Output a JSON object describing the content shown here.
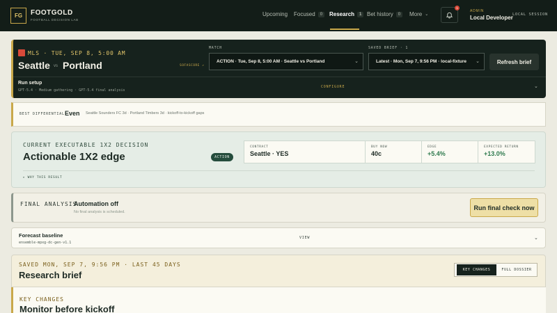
{
  "brand": {
    "logo": "FG",
    "name": "FOOTGOLD",
    "tagline": "FOOTBALL DECISION LAB"
  },
  "nav": [
    {
      "label": "Upcoming"
    },
    {
      "label": "Focused",
      "count": "0"
    },
    {
      "label": "Research",
      "count": "1",
      "active": true
    },
    {
      "label": "Bet history",
      "count": "0"
    },
    {
      "label": "More"
    }
  ],
  "notifications": {
    "count": "1",
    "icon": "bell-icon"
  },
  "user": {
    "role": "ADMIN",
    "name": "Local Developer",
    "session": "LOCAL SESSION"
  },
  "match": {
    "league": "MLS · TUE, SEP 8, 5:00 AM",
    "home": "Seattle",
    "vs": "vs",
    "away": "Portland",
    "source": "SOFASCORE ↗",
    "match_label": "MATCH",
    "match_value": "ACTION · Tue, Sep 8, 5:00 AM · Seattle vs Portland",
    "saved_label": "SAVED BRIEF · 1",
    "saved_value": "Latest · Mon, Sep 7, 9:56 PM · local-fixture",
    "refresh_label": "Refresh brief"
  },
  "run_setup": {
    "title": "Run setup",
    "meta": "GPT-5.4 · Medium gathering · GPT-5.4 final analysis",
    "configure": "CONFIGURE"
  },
  "best_differential": {
    "label": "BEST DIFFERENTIAL",
    "value": "Even",
    "note": "Seattle Sounders FC 3d · Portland Timbers 3d · kickoff-to-kickoff gaps"
  },
  "decision": {
    "label": "CURRENT EXECUTABLE 1X2 DECISION",
    "title": "Actionable 1X2 edge",
    "pill": "ACTION",
    "stats": [
      {
        "label": "CONTRACT",
        "value": "Seattle · YES"
      },
      {
        "label": "BUY NOW",
        "value": "40c"
      },
      {
        "label": "EDGE",
        "value": "+5.4%"
      },
      {
        "label": "EXPECTED RETURN",
        "value": "+13.0%"
      }
    ],
    "why": "▸ WHY THIS RESULT"
  },
  "final_analysis": {
    "label": "FINAL ANALYSIS",
    "title": "Automation off",
    "note": "No final analysis is scheduled.",
    "button": "Run final check now"
  },
  "forecast": {
    "title": "Forecast baseline",
    "model": "ensemble-mpxg-dc-gen-v1.1",
    "view": "VIEW"
  },
  "research_brief": {
    "label": "SAVED MON, SEP 7, 9:56 PM · LAST 45 DAYS",
    "title": "Research brief",
    "tabs": [
      {
        "label": "KEY CHANGES",
        "active": true
      },
      {
        "label": "FULL DOSSIER"
      }
    ],
    "key_label": "KEY CHANGES",
    "key_title": "Monitor before kickoff"
  },
  "colors": {
    "accent": "#c9a84a",
    "dark": "#16221d",
    "positive": "#2f7a4e",
    "alert": "#d94a3a"
  }
}
